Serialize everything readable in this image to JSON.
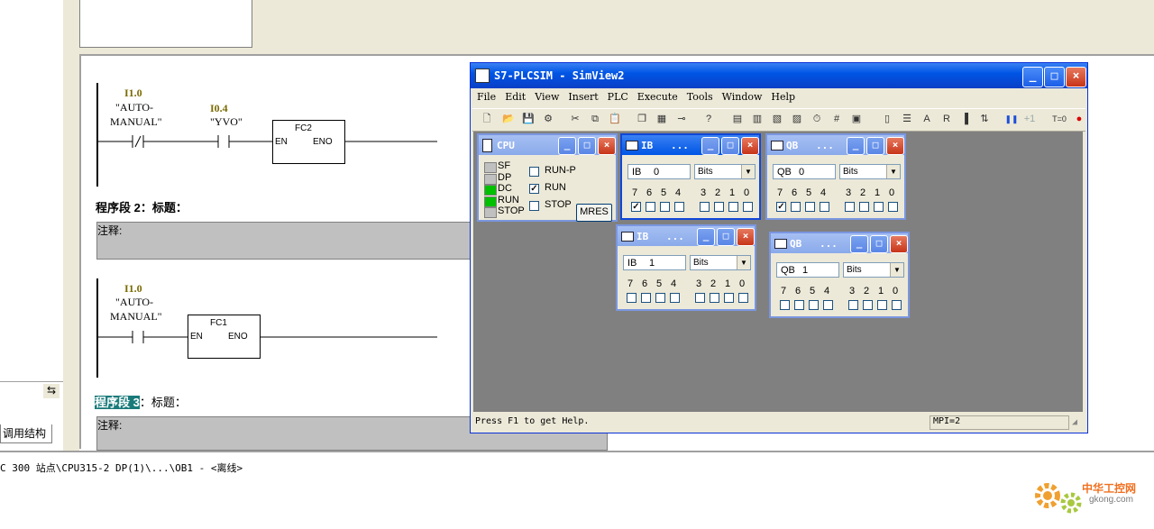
{
  "background": {
    "left_tab_label": "调用结构",
    "left_icon_glyph": "⇆",
    "network1": {
      "contacts": [
        {
          "address": "I1.0",
          "symbol_line1": "\"AUTO-",
          "symbol_line2": "MANUAL\""
        },
        {
          "address": "I0.4",
          "symbol_line1": "\"YVO\"",
          "symbol_line2": ""
        }
      ],
      "block": {
        "name": "FC2",
        "en": "EN",
        "eno": "ENO"
      }
    },
    "network2": {
      "title": "程序段 2：标题：",
      "comment": "注释:",
      "contacts": [
        {
          "address": "I1.0",
          "symbol_line1": "\"AUTO-",
          "symbol_line2": "MANUAL\""
        }
      ],
      "block": {
        "name": "FC1",
        "en": "EN",
        "eno": "ENO"
      }
    },
    "network3": {
      "title_highlight": "程序段 3",
      "title_rest": "：标题：",
      "comment": "注释:"
    },
    "status_path": "C 300 站点\\CPU315-2 DP(1)\\...\\OB1 - <离线>"
  },
  "plcsim": {
    "title": "S7-PLCSIM - SimView2",
    "title_buttons": [
      "_",
      "□",
      "×"
    ],
    "menu": [
      "File",
      "Edit",
      "View",
      "Insert",
      "PLC",
      "Execute",
      "Tools",
      "Window",
      "Help"
    ],
    "toolbar_icons": [
      "new-icon",
      "open-icon",
      "save-icon",
      "network-icon",
      "cut-icon",
      "copy-icon",
      "paste-icon",
      "cascade-icon",
      "tile-icon",
      "pin-icon",
      "help-pointer-icon",
      "input-var-icon",
      "peripheral-input-icon",
      "marker-icon",
      "output-var-icon",
      "timer-icon",
      "counter-icon",
      "generic-var-icon",
      "vertical-bits-icon",
      "stack-icon",
      "accumulator-icon",
      "block-regs-icon",
      "record-icon",
      "playback-icon",
      "pause-icon",
      "next-scan-icon",
      "reset-timer-icon",
      "breakpoint-icon"
    ],
    "toolbar_glyphs": [
      "🗋",
      "📂",
      "💾",
      "⚙",
      "✂",
      "⧉",
      "📋",
      "❐",
      "▦",
      "⊸",
      "?",
      "▤",
      "▥",
      "▧",
      "▨",
      "⏱",
      "#",
      "▣",
      "▯",
      "☰",
      "A",
      "R",
      "▐",
      "⇅",
      "❚❚",
      "+1",
      "T=0",
      "●"
    ],
    "toolbar_label_plus1": "+1",
    "toolbar_label_t0": "T=0",
    "status_help": "Press F1 to get Help.",
    "status_mpi": "MPI=2",
    "cpu": {
      "title": "CPU",
      "leds": [
        {
          "label": "SF",
          "on": false
        },
        {
          "label": "DP",
          "on": false
        },
        {
          "label": "DC",
          "on": true
        },
        {
          "label": "RUN",
          "on": true
        },
        {
          "label": "STOP",
          "on": false
        }
      ],
      "modes": [
        {
          "label": "RUN-P",
          "checked": false
        },
        {
          "label": "RUN",
          "checked": true
        },
        {
          "label": "STOP",
          "checked": false
        }
      ],
      "mres": "MRES"
    },
    "var_windows": [
      {
        "title": "IB",
        "dots": "...",
        "area": "IB",
        "address": "0",
        "format": "Bits",
        "bits_checked": [
          true,
          false,
          false,
          false,
          false,
          false,
          false,
          false
        ]
      },
      {
        "title": "QB",
        "dots": "...",
        "area": "QB",
        "address": "0",
        "format": "Bits",
        "bits_checked": [
          true,
          false,
          false,
          false,
          false,
          false,
          false,
          false
        ]
      },
      {
        "title": "IB",
        "dots": "...",
        "area": "IB",
        "address": "1",
        "format": "Bits",
        "bits_checked": [
          false,
          false,
          false,
          false,
          false,
          false,
          false,
          false
        ]
      },
      {
        "title": "QB",
        "dots": "...",
        "area": "QB",
        "address": "1",
        "format": "Bits",
        "bits_checked": [
          false,
          false,
          false,
          false,
          false,
          false,
          false,
          false
        ]
      }
    ],
    "bit_labels": [
      "7",
      "6",
      "5",
      "4",
      "3",
      "2",
      "1",
      "0"
    ]
  },
  "watermark": {
    "text_cn": "中华工控网",
    "text_url": "gkong.com"
  },
  "colors": {
    "title_blue": "#0055e5",
    "led_green": "#00c000",
    "olive_address": "#7a6a00",
    "client_gray": "#808080"
  }
}
